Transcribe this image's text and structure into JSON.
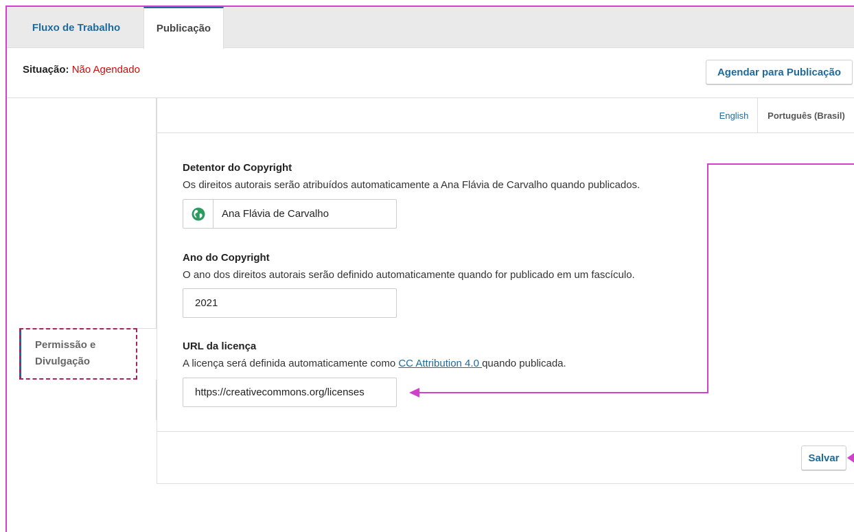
{
  "tabs": {
    "workflow": "Fluxo de Trabalho",
    "publication": "Publicação"
  },
  "status": {
    "label": "Situação:",
    "value": "Não Agendado"
  },
  "actions": {
    "schedule": "Agendar para Publicação",
    "save": "Salvar"
  },
  "locales": {
    "english": "English",
    "portuguese": "Português (Brasil)"
  },
  "sidebar": {
    "item_line1": "Permissão e",
    "item_line2": "Divulgação"
  },
  "form": {
    "copyright_holder": {
      "title": "Detentor do Copyright",
      "description": "Os direitos autorais serão atribuídos automaticamente a Ana Flávia de Carvalho quando publicados.",
      "value": "Ana Flávia de Carvalho",
      "icon": "globe-icon"
    },
    "copyright_year": {
      "title": "Ano do Copyright",
      "description": "O ano dos direitos autorais serão definido automaticamente quando for publicado em um fascículo.",
      "value": "2021"
    },
    "license_url": {
      "title": "URL da licença",
      "description_before": "A licença será definida automaticamente como ",
      "link": "CC Attribution 4.0 ",
      "description_after": "quando publicada.",
      "value": "https://creativecommons.org/licenses"
    }
  },
  "colors": {
    "accent": "#1e6a9c",
    "status": "#d00a0a",
    "annotation": "#d23fcb",
    "dashed_box": "#a3245f",
    "globe": "#2e9b5e"
  }
}
